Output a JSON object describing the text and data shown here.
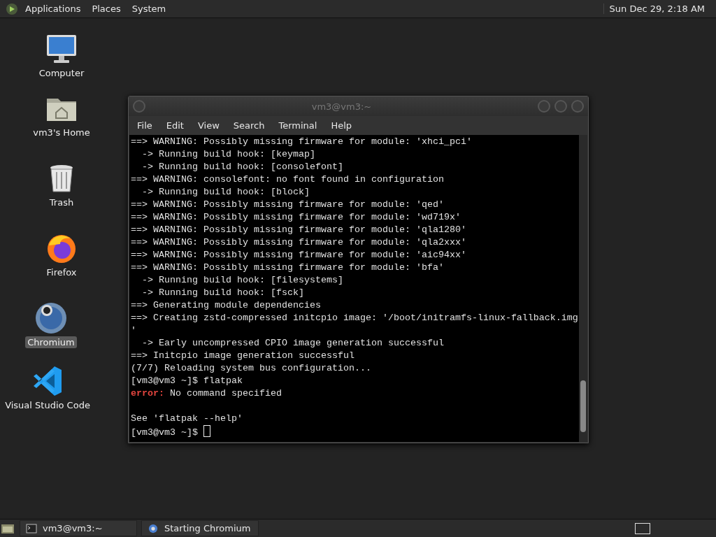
{
  "top_panel": {
    "menus": [
      "Applications",
      "Places",
      "System"
    ],
    "clock": "Sun Dec 29,  2:18 AM"
  },
  "desktop_icons": [
    {
      "kind": "computer",
      "label": "Computer",
      "selected": false
    },
    {
      "kind": "home",
      "label": "vm3's Home",
      "selected": false
    },
    {
      "kind": "trash",
      "label": "Trash",
      "selected": false
    },
    {
      "kind": "firefox",
      "label": "Firefox",
      "selected": false
    },
    {
      "kind": "chromium",
      "label": "Chromium",
      "selected": true
    },
    {
      "kind": "vscode",
      "label": "Visual Studio Code",
      "selected": false
    }
  ],
  "terminal": {
    "title": "vm3@vm3:~",
    "menu": [
      "File",
      "Edit",
      "View",
      "Search",
      "Terminal",
      "Help"
    ],
    "lines": [
      {
        "text": "==> WARNING: Possibly missing firmware for module: 'xhci_pci'"
      },
      {
        "text": "  -> Running build hook: [keymap]"
      },
      {
        "text": "  -> Running build hook: [consolefont]"
      },
      {
        "text": "==> WARNING: consolefont: no font found in configuration"
      },
      {
        "text": "  -> Running build hook: [block]"
      },
      {
        "text": "==> WARNING: Possibly missing firmware for module: 'qed'"
      },
      {
        "text": "==> WARNING: Possibly missing firmware for module: 'wd719x'"
      },
      {
        "text": "==> WARNING: Possibly missing firmware for module: 'qla1280'"
      },
      {
        "text": "==> WARNING: Possibly missing firmware for module: 'qla2xxx'"
      },
      {
        "text": "==> WARNING: Possibly missing firmware for module: 'aic94xx'"
      },
      {
        "text": "==> WARNING: Possibly missing firmware for module: 'bfa'"
      },
      {
        "text": "  -> Running build hook: [filesystems]"
      },
      {
        "text": "  -> Running build hook: [fsck]"
      },
      {
        "text": "==> Generating module dependencies"
      },
      {
        "text": "==> Creating zstd-compressed initcpio image: '/boot/initramfs-linux-fallback.img"
      },
      {
        "text": "'"
      },
      {
        "text": "  -> Early uncompressed CPIO image generation successful"
      },
      {
        "text": "==> Initcpio image generation successful"
      },
      {
        "text": "(7/7) Reloading system bus configuration..."
      },
      {
        "text": "[vm3@vm3 ~]$ flatpak"
      },
      {
        "kind": "error",
        "label": "error:",
        "text": " No command specified"
      },
      {
        "kind": "blank"
      },
      {
        "text": "See 'flatpak --help'"
      },
      {
        "text": "[vm3@vm3 ~]$ ",
        "cursor": true
      }
    ]
  },
  "taskbar": {
    "items": [
      {
        "kind": "terminal",
        "label": "vm3@vm3:~"
      },
      {
        "kind": "chromium",
        "label": "Starting Chromium"
      }
    ]
  }
}
